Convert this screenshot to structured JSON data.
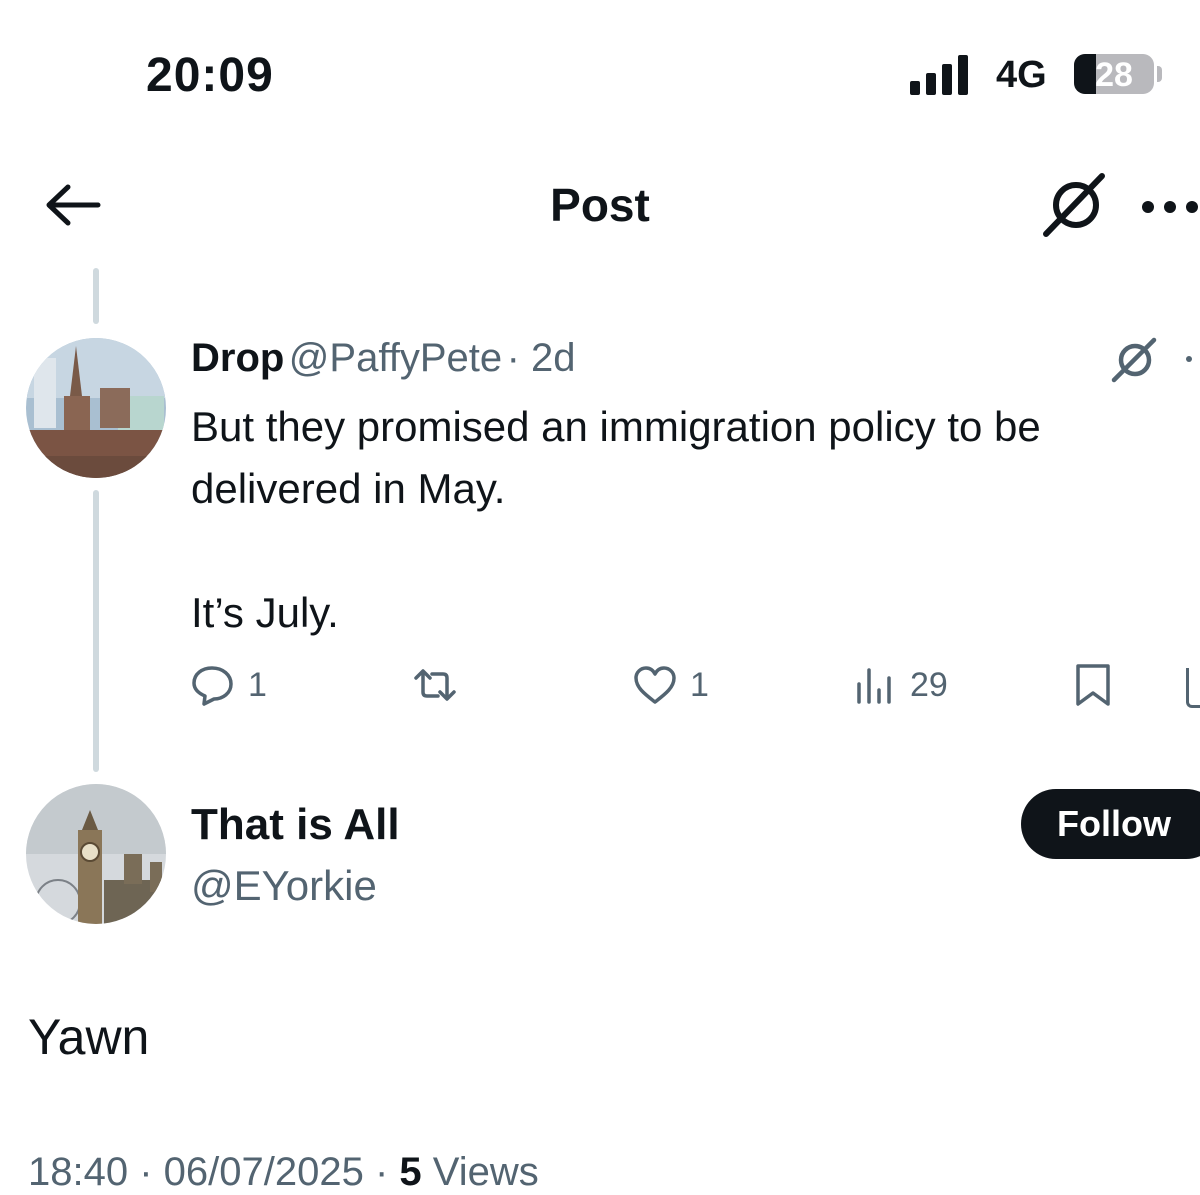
{
  "status_bar": {
    "time": "20:09",
    "network": "4G",
    "battery_level": "28",
    "battery_fraction": 0.28
  },
  "header": {
    "title": "Post",
    "icons": [
      "back-arrow-icon",
      "grok-icon",
      "more-icon"
    ]
  },
  "parent_post": {
    "display_name": "Drop",
    "handle": "@PaffyPete",
    "age": "· 2d",
    "text": "But they promised an immigration policy to be delivered in May.\n\nIt’s July.",
    "stats": {
      "replies": "1",
      "retweets": "",
      "likes": "1",
      "views": "29"
    }
  },
  "reply_post": {
    "display_name": "That is All",
    "handle": "@EYorkie",
    "follow_label": "Follow",
    "text": "Yawn",
    "timestamp": "18:40 · 06/07/2025 ·",
    "views_count": "5",
    "views_label": "Views"
  },
  "colors": {
    "text": "#0f1419",
    "secondary": "#536471",
    "thread_line": "#cfd9de",
    "button_bg": "#0f1419"
  }
}
